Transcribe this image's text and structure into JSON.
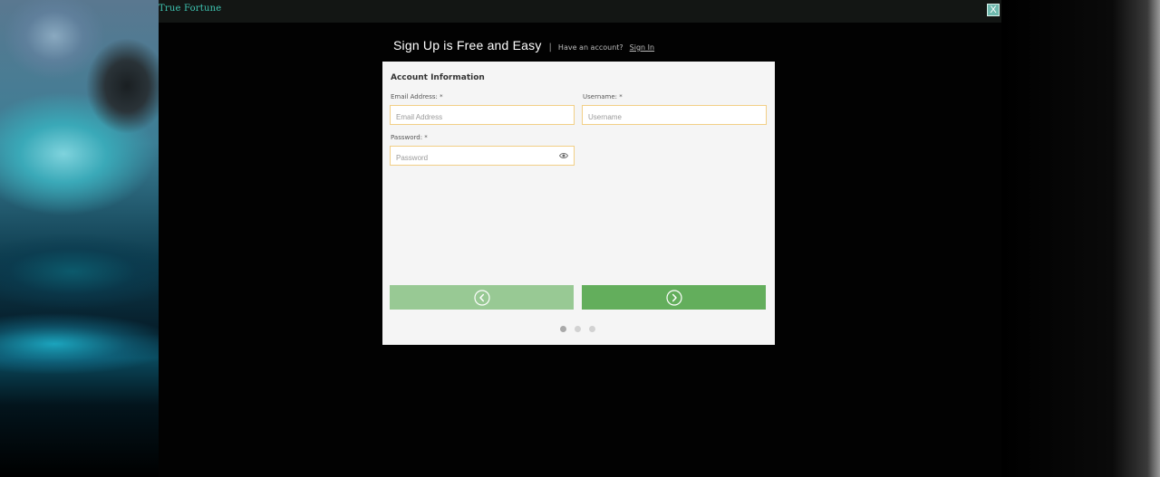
{
  "window": {
    "brand": "True Fortune",
    "close_label": "X"
  },
  "header": {
    "title": "Sign Up is Free and Easy",
    "separator": "|",
    "have_account": "Have an account?",
    "sign_in": "Sign In"
  },
  "form": {
    "section_title": "Account Information",
    "email": {
      "label": "Email Address: *",
      "placeholder": "Email Address",
      "value": ""
    },
    "username": {
      "label": "Username: *",
      "placeholder": "Username",
      "value": ""
    },
    "password": {
      "label": "Password: *",
      "placeholder": "Password",
      "value": ""
    }
  },
  "nav": {
    "prev_icon": "chevron-left-icon",
    "next_icon": "chevron-right-icon"
  },
  "steps": {
    "total": 3,
    "current": 1
  },
  "colors": {
    "brand": "#3fc6b3",
    "field_border": "#f2cf86",
    "prev_button": "#98c994",
    "next_button": "#63ae5c"
  }
}
